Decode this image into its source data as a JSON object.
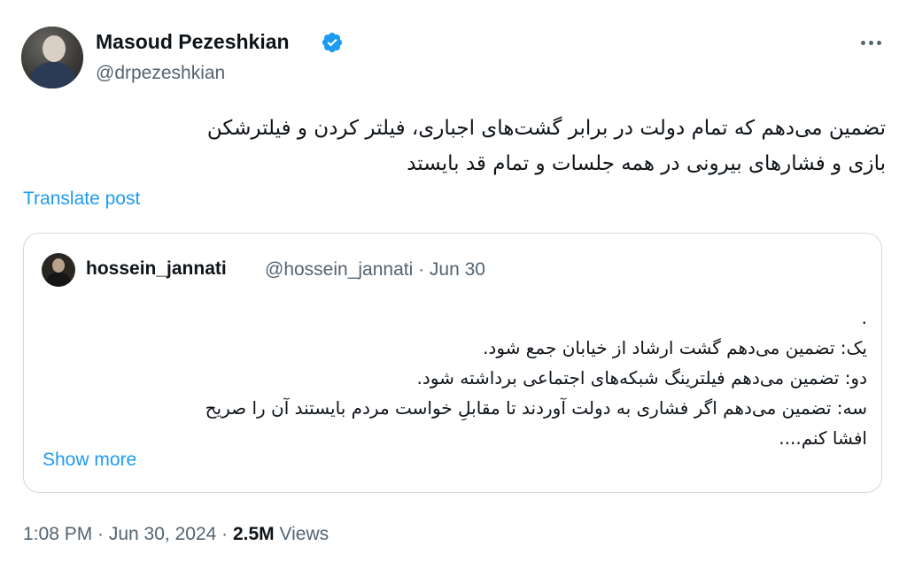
{
  "author": {
    "display_name": "Masoud Pezeshkian",
    "handle": "@drpezeshkian",
    "verified_color": "#1d9bf0"
  },
  "tweet": {
    "lines": [
      "تضمین می‌دهم که تمام دولت در برابر  گشت‌های اجباری، فیلتر کردن و فیلترشکن",
      "بازی و فشارهای بیرونی در همه جلسات و تمام قد بایستد"
    ],
    "translate_label": "Translate post"
  },
  "quoted": {
    "name": "hossein_jannati",
    "meta": "@hossein_jannati · Jun 30",
    "lines": [
      ".",
      "یک: تضمین می‌دهم گشت ارشاد از خیابان جمع شود.",
      "دو: تضمین می‌دهم فیلترینگ شبکه‌های اجتماعی برداشته شود.",
      "سه: تضمین می‌دهم اگر فشاری به دولت آوردند تا مقابلِ خواست مردم بایستند آن را صریح",
      "افشا کنم...."
    ],
    "show_more_label": "Show more"
  },
  "footer": {
    "timestamp": "1:08 PM · Jun 30, 2024 · ",
    "views_count": "2.5M",
    "views_label": " Views"
  },
  "icons": {
    "more": "more-horizontal-icon",
    "verified": "verified-badge-icon"
  },
  "colors": {
    "accent": "#1d9bf0",
    "secondary_text": "#536471",
    "border": "#cfd9de"
  }
}
